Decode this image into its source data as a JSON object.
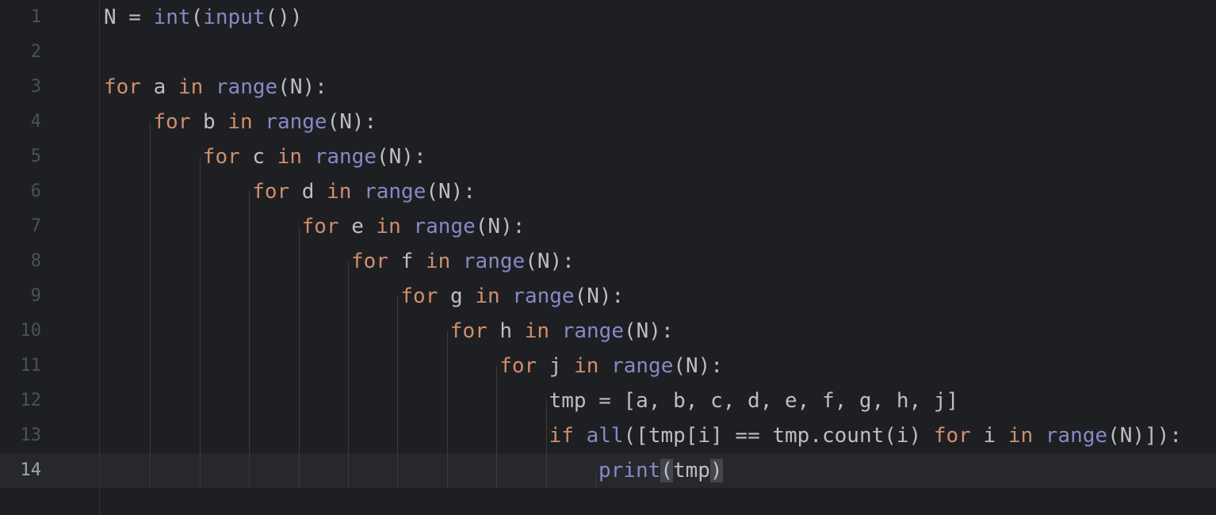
{
  "editor": {
    "current_line": 14,
    "lines": [
      {
        "number": "1",
        "indent": 0,
        "tokens": [
          {
            "t": "N = ",
            "c": "plain"
          },
          {
            "t": "int",
            "c": "bi"
          },
          {
            "t": "(",
            "c": "plain"
          },
          {
            "t": "input",
            "c": "bi"
          },
          {
            "t": "())",
            "c": "plain"
          }
        ]
      },
      {
        "number": "2",
        "indent": 0,
        "tokens": []
      },
      {
        "number": "3",
        "indent": 0,
        "tokens": [
          {
            "t": "for",
            "c": "kw"
          },
          {
            "t": " a ",
            "c": "plain"
          },
          {
            "t": "in",
            "c": "kw"
          },
          {
            "t": " ",
            "c": "plain"
          },
          {
            "t": "range",
            "c": "bi"
          },
          {
            "t": "(N):",
            "c": "plain"
          }
        ]
      },
      {
        "number": "4",
        "indent": 1,
        "tokens": [
          {
            "t": "for",
            "c": "kw"
          },
          {
            "t": " b ",
            "c": "plain"
          },
          {
            "t": "in",
            "c": "kw"
          },
          {
            "t": " ",
            "c": "plain"
          },
          {
            "t": "range",
            "c": "bi"
          },
          {
            "t": "(N):",
            "c": "plain"
          }
        ]
      },
      {
        "number": "5",
        "indent": 2,
        "tokens": [
          {
            "t": "for",
            "c": "kw"
          },
          {
            "t": " c ",
            "c": "plain"
          },
          {
            "t": "in",
            "c": "kw"
          },
          {
            "t": " ",
            "c": "plain"
          },
          {
            "t": "range",
            "c": "bi"
          },
          {
            "t": "(N):",
            "c": "plain"
          }
        ]
      },
      {
        "number": "6",
        "indent": 3,
        "tokens": [
          {
            "t": "for",
            "c": "kw"
          },
          {
            "t": " d ",
            "c": "plain"
          },
          {
            "t": "in",
            "c": "kw"
          },
          {
            "t": " ",
            "c": "plain"
          },
          {
            "t": "range",
            "c": "bi"
          },
          {
            "t": "(N):",
            "c": "plain"
          }
        ]
      },
      {
        "number": "7",
        "indent": 4,
        "tokens": [
          {
            "t": "for",
            "c": "kw"
          },
          {
            "t": " e ",
            "c": "plain"
          },
          {
            "t": "in",
            "c": "kw"
          },
          {
            "t": " ",
            "c": "plain"
          },
          {
            "t": "range",
            "c": "bi"
          },
          {
            "t": "(N):",
            "c": "plain"
          }
        ]
      },
      {
        "number": "8",
        "indent": 5,
        "tokens": [
          {
            "t": "for",
            "c": "kw"
          },
          {
            "t": " f ",
            "c": "plain"
          },
          {
            "t": "in",
            "c": "kw"
          },
          {
            "t": " ",
            "c": "plain"
          },
          {
            "t": "range",
            "c": "bi"
          },
          {
            "t": "(N):",
            "c": "plain"
          }
        ]
      },
      {
        "number": "9",
        "indent": 6,
        "tokens": [
          {
            "t": "for",
            "c": "kw"
          },
          {
            "t": " g ",
            "c": "plain"
          },
          {
            "t": "in",
            "c": "kw"
          },
          {
            "t": " ",
            "c": "plain"
          },
          {
            "t": "range",
            "c": "bi"
          },
          {
            "t": "(N):",
            "c": "plain"
          }
        ]
      },
      {
        "number": "10",
        "indent": 7,
        "tokens": [
          {
            "t": "for",
            "c": "kw"
          },
          {
            "t": " h ",
            "c": "plain"
          },
          {
            "t": "in",
            "c": "kw"
          },
          {
            "t": " ",
            "c": "plain"
          },
          {
            "t": "range",
            "c": "bi"
          },
          {
            "t": "(N):",
            "c": "plain"
          }
        ]
      },
      {
        "number": "11",
        "indent": 8,
        "tokens": [
          {
            "t": "for",
            "c": "kw"
          },
          {
            "t": " j ",
            "c": "plain"
          },
          {
            "t": "in",
            "c": "kw"
          },
          {
            "t": " ",
            "c": "plain"
          },
          {
            "t": "range",
            "c": "bi"
          },
          {
            "t": "(N):",
            "c": "plain"
          }
        ]
      },
      {
        "number": "12",
        "indent": 9,
        "tokens": [
          {
            "t": "tmp = [a, b, c, d, e, f, g, h, j]",
            "c": "plain"
          }
        ]
      },
      {
        "number": "13",
        "indent": 9,
        "tokens": [
          {
            "t": "if",
            "c": "kw"
          },
          {
            "t": " ",
            "c": "plain"
          },
          {
            "t": "all",
            "c": "bi"
          },
          {
            "t": "([tmp[i] == tmp.count(i) ",
            "c": "plain"
          },
          {
            "t": "for",
            "c": "kw"
          },
          {
            "t": " i ",
            "c": "plain"
          },
          {
            "t": "in",
            "c": "kw"
          },
          {
            "t": " ",
            "c": "plain"
          },
          {
            "t": "range",
            "c": "bi"
          },
          {
            "t": "(N)]):",
            "c": "plain"
          }
        ]
      },
      {
        "number": "14",
        "indent": 10,
        "tokens": [
          {
            "t": "print",
            "c": "bi"
          },
          {
            "t": "(",
            "c": "plain",
            "hl": true
          },
          {
            "t": "tmp",
            "c": "plain"
          },
          {
            "t": ")",
            "c": "plain",
            "hl": true
          }
        ]
      }
    ]
  }
}
